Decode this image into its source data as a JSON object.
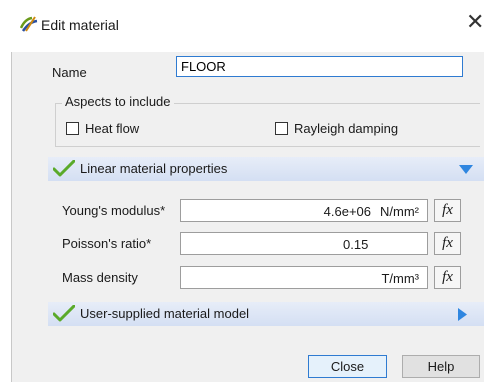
{
  "window": {
    "title": "Edit material",
    "close_glyph": "✕"
  },
  "name_field": {
    "label": "Name",
    "value": "FLOOR"
  },
  "aspects": {
    "title": "Aspects to include",
    "heat_flow": {
      "label": "Heat flow",
      "checked": false
    },
    "rayleigh": {
      "label": "Rayleigh damping",
      "checked": false
    }
  },
  "linear_section": {
    "label": "Linear material properties",
    "expanded": true
  },
  "properties": [
    {
      "label": "Young's modulus*",
      "value": "4.6e+06",
      "unit": "N/mm²",
      "fx": "fx"
    },
    {
      "label": "Poisson's ratio*",
      "value": "0.15",
      "unit": "",
      "fx": "fx"
    },
    {
      "label": "Mass density",
      "value": "",
      "unit": "T/mm³",
      "fx": "fx"
    }
  ],
  "user_section": {
    "label": "User-supplied material model",
    "expanded": false
  },
  "buttons": {
    "close": "Close",
    "help": "Help"
  },
  "colors": {
    "accent": "#2f7bd1",
    "section_bar": "#dce5f5",
    "check": "#5aaa2a"
  }
}
